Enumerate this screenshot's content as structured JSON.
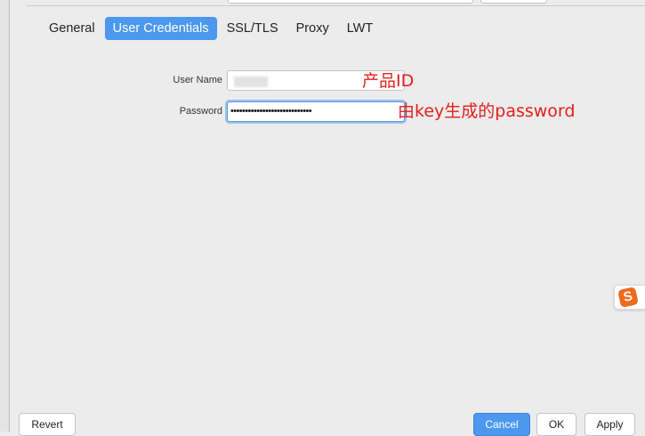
{
  "tabs": [
    {
      "label": "General",
      "active": false
    },
    {
      "label": "User Credentials",
      "active": true
    },
    {
      "label": "SSL/TLS",
      "active": false
    },
    {
      "label": "Proxy",
      "active": false
    },
    {
      "label": "LWT",
      "active": false
    }
  ],
  "form": {
    "username_label": "User Name",
    "username_value": "",
    "password_label": "Password",
    "password_value": "••••••••••••••••••••••••••••"
  },
  "annotations": {
    "username_note": "产品ID",
    "password_note": "由key生成的password",
    "color": "#e3201b"
  },
  "ime_indicator": {
    "glyph": "S",
    "icon": "sogou-ime-icon"
  },
  "buttons": {
    "revert": "Revert",
    "cancel": "Cancel",
    "ok": "OK",
    "apply": "Apply"
  },
  "colors": {
    "accent": "#4c98ef",
    "background": "#ececec"
  }
}
